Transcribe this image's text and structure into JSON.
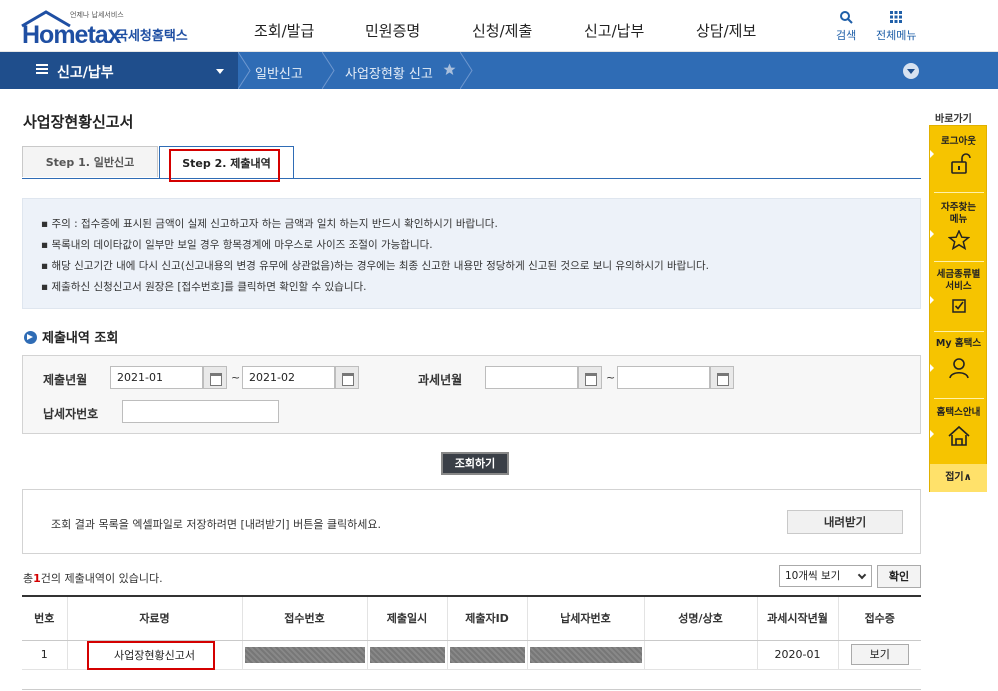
{
  "header": {
    "logo_text": "Hometax",
    "logo_kr": "국세청홈택스",
    "logo_small": "언제나 납세서비스",
    "gnb": [
      "조회/발급",
      "민원증명",
      "신청/제출",
      "신고/납부",
      "상담/제보"
    ],
    "search_label": "검색",
    "menu_label": "전체메뉴"
  },
  "nav": {
    "current": "신고/납부",
    "crumbs": [
      "일반신고",
      "사업장현황 신고"
    ]
  },
  "page": {
    "title": "사업장현황신고서",
    "tabs": [
      "Step 1. 일반신고",
      "Step 2. 제출내역"
    ],
    "notices": [
      "주의 : 접수증에 표시된 금액이 실제 신고하고자 하는 금액과 일치 하는지 반드시 확인하시기 바랍니다.",
      "목록내의 데이타값이 일부만 보일 경우 항목경계에 마우스로 사이즈 조절이 가능합니다.",
      "해당 신고기간 내에 다시 신고(신고내용의 변경 유무에 상관없음)하는 경우에는 최종 신고한 내용만 정당하게 신고된 것으로 보니 유의하시기 바랍니다.",
      "제출하신 신청신고서 원장은 [접수번호]를 클릭하면 확인할 수 있습니다."
    ]
  },
  "search": {
    "section_title": "제출내역 조회",
    "submit_month_label": "제출년월",
    "from": "2021-01",
    "to": "2021-02",
    "tilde": "~",
    "tax_month_label": "과세년월",
    "tax_from": "",
    "tax_to": "",
    "taxpayer_label": "납세자번호",
    "taxpayer_value": "",
    "button": "조회하기"
  },
  "download": {
    "text": "조회 결과 목록을 엑셀파일로 저장하려면 [내려받기] 버튼을 클릭하세요.",
    "button": "내려받기"
  },
  "results": {
    "count_prefix": "총",
    "count": "1",
    "count_suffix": "건의 제출내역이 있습니다.",
    "page_size": "10개씩 보기",
    "confirm": "확인",
    "columns": [
      "번호",
      "자료명",
      "접수번호",
      "제출일시",
      "제출자ID",
      "납세자번호",
      "성명/상호",
      "과세시작년월",
      "접수증"
    ],
    "rows": [
      {
        "no": "1",
        "name": "사업장현황신고서",
        "receipt_no": "",
        "submitted_at": "",
        "submitter_id": "",
        "taxpayer_no": "",
        "person": "",
        "tax_start": "2020-01",
        "view": "보기"
      }
    ]
  },
  "quick": {
    "title": "바로가기",
    "items": [
      "로그아웃",
      "자주찾는 메뉴",
      "세금종류별 서비스",
      "My 홈택스",
      "홈택스안내"
    ],
    "fold": "접기∧"
  },
  "colors": {
    "brand": "#1f4fa3",
    "nav": "#2f6cb5",
    "nav_dark": "#1f4e8c",
    "quick": "#f6c400",
    "highlight": "#d40000"
  }
}
